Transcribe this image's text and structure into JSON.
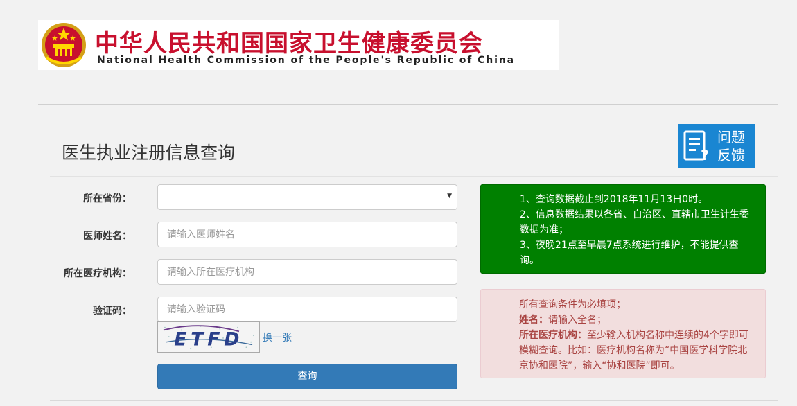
{
  "banner": {
    "title_cn": "中华人民共和国国家卫生健康委员会",
    "title_en": "National Health Commission of the People's Republic of China"
  },
  "page": {
    "title": "医生执业注册信息查询"
  },
  "feedback": {
    "line1": "问题",
    "line2": "反馈"
  },
  "form": {
    "province_label": "所在省份：",
    "province_value": "",
    "name_label": "医师姓名：",
    "name_placeholder": "请输入医师姓名",
    "institution_label": "所在医疗机构：",
    "institution_placeholder": "请输入所在医疗机构",
    "captcha_label": "验证码：",
    "captcha_placeholder": "请输入验证码",
    "captcha_text": "ETFD",
    "swap_label": "换一张",
    "submit_label": "查询"
  },
  "notice_info": {
    "line1": "1、查询数据截止到2018年11月13日0时。",
    "line2": "2、信息数据结果以各省、自治区、直辖市卫生计生委数据为准；",
    "line3": "3、夜晚21点至早晨7点系统进行维护，不能提供查询。"
  },
  "notice_rules": {
    "line1": "所有查询条件为必填项；",
    "name_key": "姓名：",
    "name_text": "请输入全名；",
    "inst_key": "所在医疗机构：",
    "inst_text": "至少输入机构名称中连续的4个字即可模糊查询。比如：医疗机构名称为“中国医学科学院北京协和医院”，输入“协和医院”即可。"
  },
  "colors": {
    "brand_red": "#c8102e",
    "primary_blue": "#337ab7",
    "feedback_blue": "#1a86d2",
    "notice_green": "#008000",
    "notice_red_bg": "#f2dede",
    "notice_red_text": "#a94442"
  },
  "icons": {
    "emblem": "national-emblem-icon",
    "feedback": "feedback-document-icon",
    "dropdown": "caret-down-icon"
  }
}
